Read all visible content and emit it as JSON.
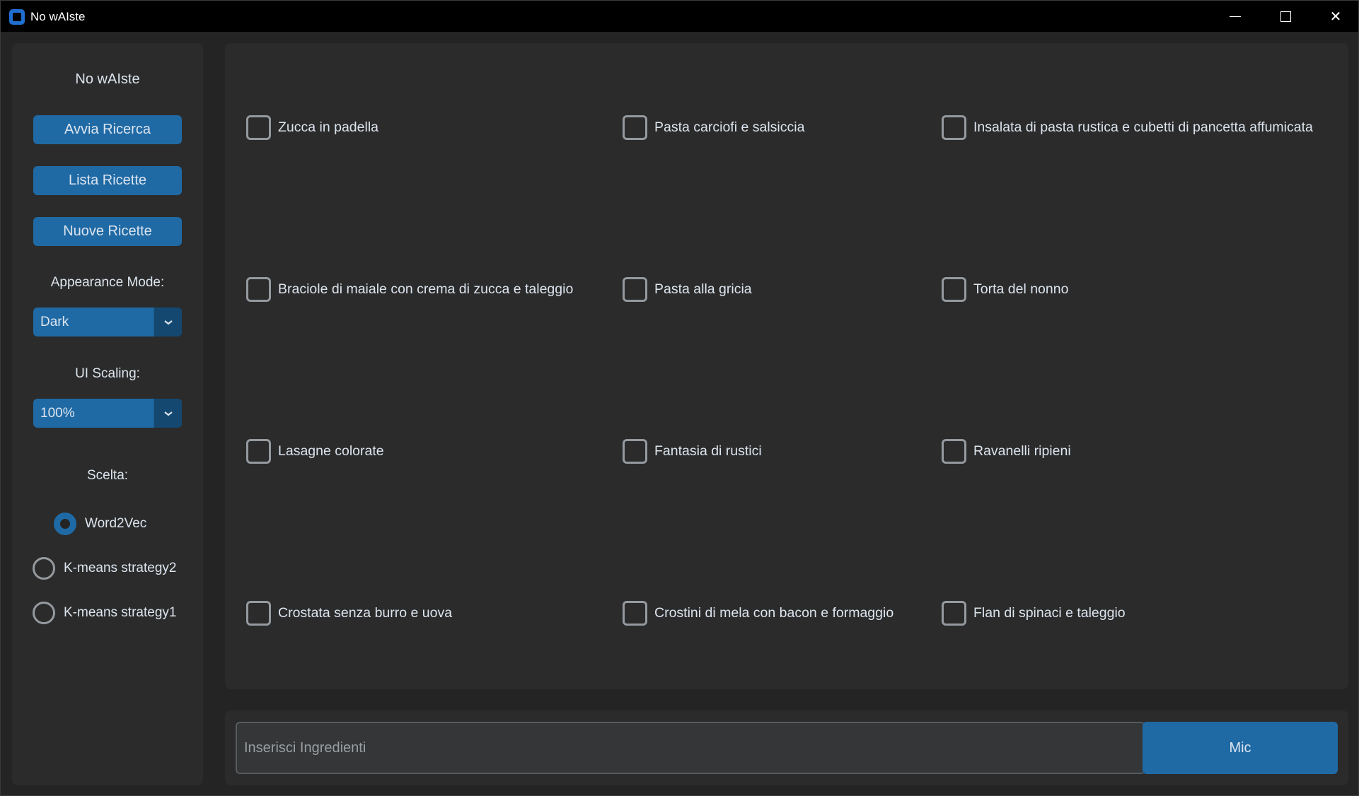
{
  "window": {
    "title": "No wAIste",
    "controls": {
      "minimize_icon": "minimize-icon",
      "maximize_icon": "maximize-icon",
      "close_icon": "close-icon",
      "close_glyph": "✕"
    }
  },
  "sidebar": {
    "title": "No wAIste",
    "buttons": [
      "Avvia Ricerca",
      "Lista Ricette",
      "Nuove Ricette"
    ],
    "appearance_label": "Appearance Mode:",
    "appearance_value": "Dark",
    "scaling_label": "UI Scaling:",
    "scaling_value": "100%",
    "choice_label": "Scelta:",
    "radios": [
      {
        "label": "Word2Vec",
        "checked": true
      },
      {
        "label": "K-means strategy2",
        "checked": false
      },
      {
        "label": "K-means strategy1",
        "checked": false
      }
    ]
  },
  "recipes": [
    [
      "Zucca in padella",
      "Pasta carciofi e salsiccia",
      "Insalata di pasta rustica e cubetti di pancetta affumicata"
    ],
    [
      "Braciole di maiale con crema di zucca e taleggio",
      "Pasta alla gricia",
      "Torta del nonno"
    ],
    [
      "Lasagne colorate",
      "Fantasia di rustici",
      "Ravanelli ripieni"
    ],
    [
      "Crostata senza burro e uova",
      "Crostini di mela con bacon e formaggio",
      "Flan di spinaci e taleggio"
    ]
  ],
  "bottom": {
    "input_placeholder": "Inserisci Ingredienti",
    "input_value": "",
    "mic_label": "Mic"
  },
  "colors": {
    "accent": "#1f6aa5",
    "background": "#242424",
    "panel": "#2b2b2b",
    "text": "#dce4ee"
  }
}
